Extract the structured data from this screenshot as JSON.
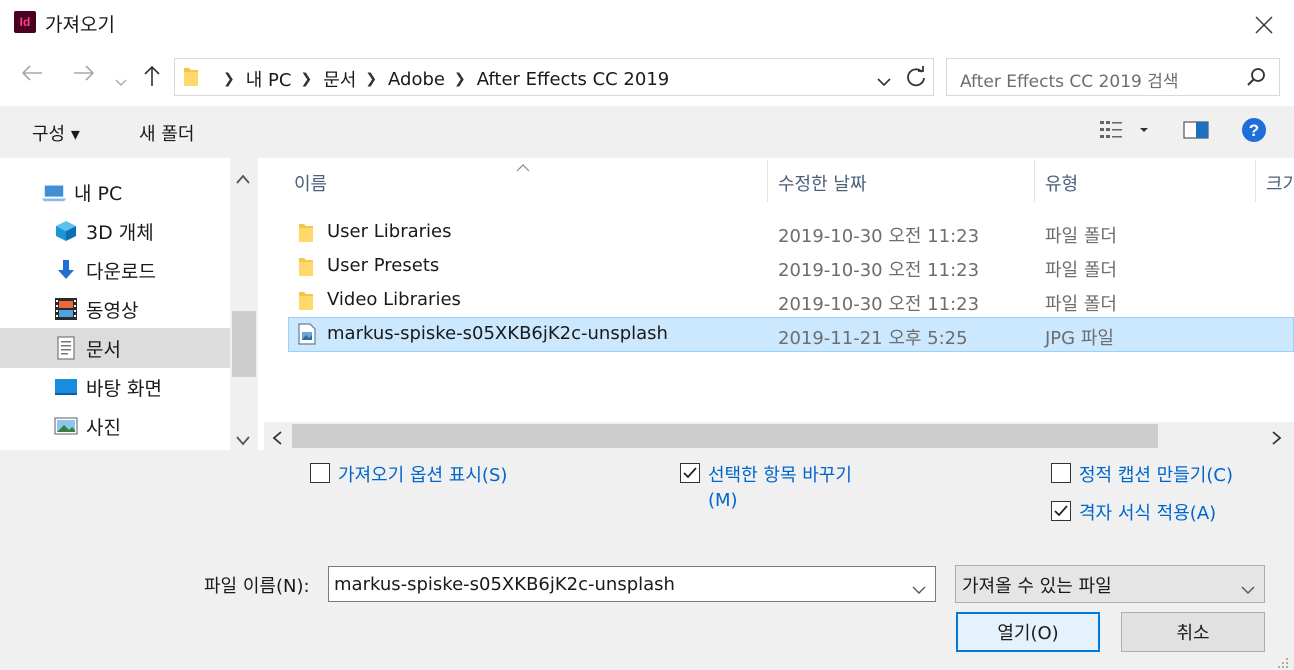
{
  "window": {
    "title": "가져오기",
    "app_icon_text": "Id"
  },
  "address": {
    "crumbs": [
      "내 PC",
      "문서",
      "Adobe",
      "After Effects CC 2019"
    ],
    "search_placeholder": "After Effects CC 2019 검색"
  },
  "toolbar": {
    "organize_label": "구성 ▾",
    "new_folder_label": "새 폴더"
  },
  "nav": {
    "items": [
      {
        "label": "내 PC",
        "icon": "pc-icon"
      },
      {
        "label": "3D 개체",
        "icon": "cube-icon"
      },
      {
        "label": "다운로드",
        "icon": "download-icon"
      },
      {
        "label": "동영상",
        "icon": "video-icon"
      },
      {
        "label": "문서",
        "icon": "document-icon"
      },
      {
        "label": "바탕 화면",
        "icon": "desktop-icon"
      },
      {
        "label": "사진",
        "icon": "picture-icon"
      }
    ],
    "selected": "문서"
  },
  "files": {
    "columns": [
      "이름",
      "수정한 날짜",
      "유형",
      "크기"
    ],
    "rows": [
      {
        "name": "User Libraries",
        "date": "2019-10-30 오전 11:23",
        "type": "파일 폴더",
        "icon": "folder-icon"
      },
      {
        "name": "User Presets",
        "date": "2019-10-30 오전 11:23",
        "type": "파일 폴더",
        "icon": "folder-icon"
      },
      {
        "name": "Video Libraries",
        "date": "2019-10-30 오전 11:23",
        "type": "파일 폴더",
        "icon": "folder-icon"
      },
      {
        "name": "markus-spiske-s05XKB6jK2c-unsplash",
        "date": "2019-11-21 오후 5:25",
        "type": "JPG 파일",
        "icon": "image-file-icon",
        "selected": true
      }
    ]
  },
  "options": {
    "show_import_options": {
      "label": "가져오기 옵션 표시(S)",
      "checked": false
    },
    "replace_selected": {
      "label_line1": "선택한 항목 바꾸기",
      "label_line2": "(M)",
      "checked": true
    },
    "static_captions": {
      "label": "정적 캡션 만들기(C)",
      "checked": false
    },
    "apply_grid": {
      "label": "격자 서식 적용(A)",
      "checked": true
    }
  },
  "filename": {
    "label": "파일 이름(N):",
    "value": "markus-spiske-s05XKB6jK2c-unsplash"
  },
  "filetype": {
    "value": "가져올 수 있는 파일"
  },
  "buttons": {
    "open": "열기(O)",
    "cancel": "취소"
  },
  "colors": {
    "accent": "#0078d7",
    "link_blue": "#0066cc",
    "selection": "#cce8ff",
    "header_text": "#4c607a"
  }
}
